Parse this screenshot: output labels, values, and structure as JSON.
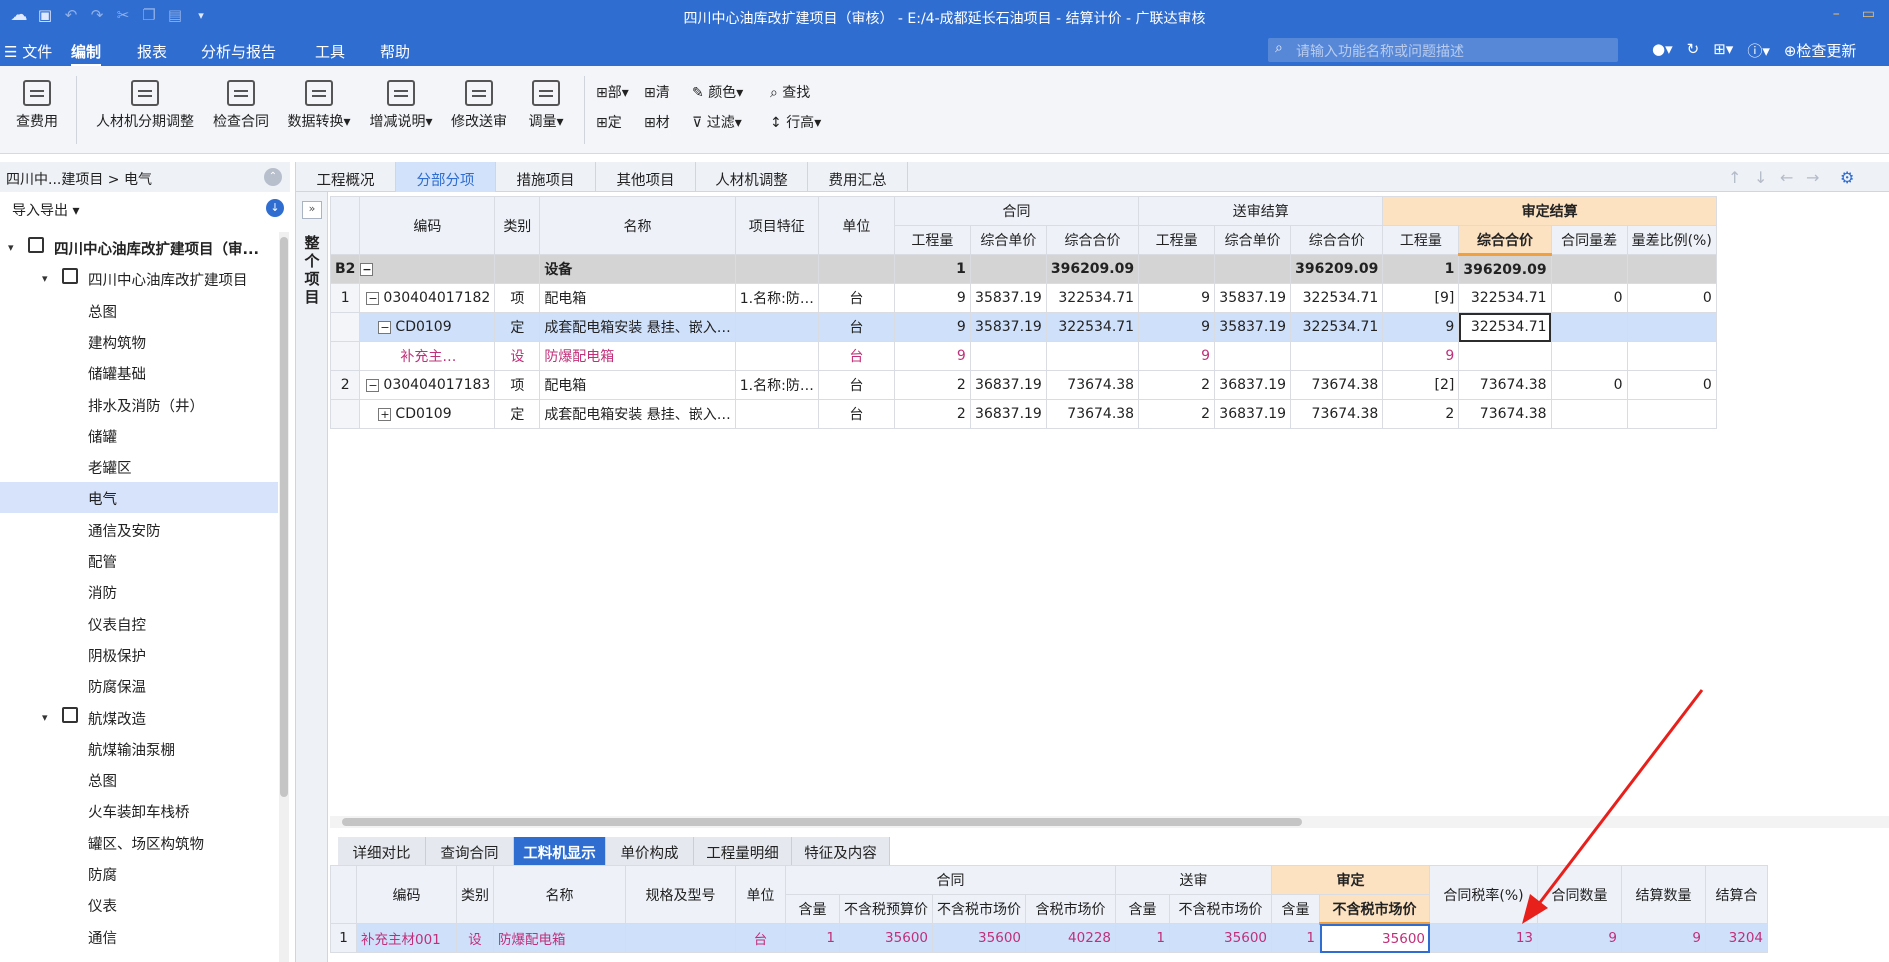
{
  "titlebar": {
    "title": "四川中心油库改扩建项目（审核） - E:/4-成都延长石油项目 - 结算计价 - 广联达审核"
  },
  "menubar": {
    "items": [
      "文件",
      "编制",
      "报表",
      "分析与报告",
      "工具",
      "帮助"
    ],
    "active": "编制",
    "search_placeholder": "请输入功能名称或问题描述",
    "check_update": "检查更新"
  },
  "ribbon": {
    "buttons": [
      "查费用",
      "人材机分期调整",
      "检查合同",
      "数据转换",
      "增减说明",
      "修改送审",
      "调量"
    ],
    "small": [
      "部",
      "清",
      "定",
      "材",
      "颜色",
      "过滤",
      "查找",
      "行高"
    ]
  },
  "leftpanel": {
    "breadcrumb": "四川中...建项目 > 电气",
    "io": "导入导出",
    "tree": [
      {
        "label": "四川中心油库改扩建项目（审...",
        "level": 0,
        "bold": true
      },
      {
        "label": "四川中心油库改扩建项目",
        "level": 1
      },
      {
        "label": "总图",
        "level": 2
      },
      {
        "label": "建构筑物",
        "level": 2
      },
      {
        "label": "储罐基础",
        "level": 2
      },
      {
        "label": "排水及消防（井）",
        "level": 2
      },
      {
        "label": "储罐",
        "level": 2
      },
      {
        "label": "老罐区",
        "level": 2
      },
      {
        "label": "电气",
        "level": 2,
        "selected": true
      },
      {
        "label": "通信及安防",
        "level": 2
      },
      {
        "label": "配管",
        "level": 2
      },
      {
        "label": "消防",
        "level": 2
      },
      {
        "label": "仪表自控",
        "level": 2
      },
      {
        "label": "阴极保护",
        "level": 2
      },
      {
        "label": "防腐保温",
        "level": 2
      },
      {
        "label": "航煤改造",
        "level": 1
      },
      {
        "label": "航煤输油泵棚",
        "level": 2
      },
      {
        "label": "总图",
        "level": 2
      },
      {
        "label": "火车装卸车栈桥",
        "level": 2
      },
      {
        "label": "罐区、场区构筑物",
        "level": 2
      },
      {
        "label": "防腐",
        "level": 2
      },
      {
        "label": "仪表",
        "level": 2
      },
      {
        "label": "通信",
        "level": 2
      }
    ]
  },
  "main": {
    "tabs": [
      "工程概况",
      "分部分项",
      "措施项目",
      "其他项目",
      "人材机调整",
      "费用汇总"
    ],
    "active_tab": "分部分项",
    "side_label": "整个项目",
    "grid": {
      "group_headers": {
        "contract": "合同",
        "submit": "送审结算",
        "approved": "审定结算"
      },
      "headers": {
        "code": "编码",
        "type": "类别",
        "name": "名称",
        "feature": "项目特征",
        "unit": "单位",
        "qty": "工程量",
        "unit_price": "综合单价",
        "total": "综合合价",
        "diff": "合同量差",
        "ratio": "量差比例(%)"
      },
      "rows": [
        {
          "no": "B2",
          "code": "",
          "type": "",
          "name": "设备",
          "feature": "",
          "unit": "",
          "c_qty": "1",
          "c_up": "",
          "c_tot": "396209.09",
          "s_qty": "",
          "s_up": "",
          "s_tot": "396209.09",
          "a_qty": "1",
          "a_tot": "396209.09",
          "diff": "",
          "ratio": ""
        },
        {
          "no": "1",
          "code": "030404017182",
          "type": "项",
          "name": "配电箱",
          "feature": "1.名称:防…",
          "unit": "台",
          "c_qty": "9",
          "c_up": "35837.19",
          "c_tot": "322534.71",
          "s_qty": "9",
          "s_up": "35837.19",
          "s_tot": "322534.71",
          "a_qty": "[9]",
          "a_tot": "322534.71",
          "diff": "0",
          "ratio": "0"
        },
        {
          "no": "",
          "code": "CD0109",
          "type": "定",
          "name": "成套配电箱安装 悬挂、嵌入…",
          "feature": "",
          "unit": "台",
          "c_qty": "9",
          "c_up": "35837.19",
          "c_tot": "322534.71",
          "s_qty": "9",
          "s_up": "35837.19",
          "s_tot": "322534.71",
          "a_qty": "9",
          "a_tot": "322534.71",
          "diff": "",
          "ratio": ""
        },
        {
          "no": "",
          "code": "补充主…",
          "type": "设",
          "name": "防爆配电箱",
          "feature": "",
          "unit": "台",
          "c_qty": "9",
          "c_up": "",
          "c_tot": "",
          "s_qty": "9",
          "s_up": "",
          "s_tot": "",
          "a_qty": "9",
          "a_tot": "",
          "diff": "",
          "ratio": ""
        },
        {
          "no": "2",
          "code": "030404017183",
          "type": "项",
          "name": "配电箱",
          "feature": "1.名称:防…",
          "unit": "台",
          "c_qty": "2",
          "c_up": "36837.19",
          "c_tot": "73674.38",
          "s_qty": "2",
          "s_up": "36837.19",
          "s_tot": "73674.38",
          "a_qty": "[2]",
          "a_tot": "73674.38",
          "diff": "0",
          "ratio": "0"
        },
        {
          "no": "",
          "code": "CD0109",
          "type": "定",
          "name": "成套配电箱安装 悬挂、嵌入…",
          "feature": "",
          "unit": "台",
          "c_qty": "2",
          "c_up": "36837.19",
          "c_tot": "73674.38",
          "s_qty": "2",
          "s_up": "36837.19",
          "s_tot": "73674.38",
          "a_qty": "2",
          "a_tot": "73674.38",
          "diff": "",
          "ratio": ""
        }
      ]
    },
    "bottom": {
      "tabs": [
        "详细对比",
        "查询合同",
        "工料机显示",
        "单价构成",
        "工程量明细",
        "特征及内容"
      ],
      "active_tab": "工料机显示",
      "group_headers": {
        "contract": "合同",
        "submit": "送审",
        "approved": "审定"
      },
      "headers": {
        "code": "编码",
        "type": "类别",
        "name": "名称",
        "spec": "规格及型号",
        "unit": "单位",
        "content": "含量",
        "ex_budget": "不含税预算价",
        "ex_market": "不含税市场价",
        "in_market": "含税市场价",
        "tax": "合同税率(%)",
        "c_count": "合同数量",
        "s_count": "结算数量",
        "s_total": "结算合"
      },
      "row": {
        "no": "1",
        "code": "补充主材001",
        "type": "设",
        "name": "防爆配电箱",
        "spec": "",
        "unit": "台",
        "c_content": "1",
        "c_ex_budget": "35600",
        "c_ex_market": "35600",
        "c_in_market": "40228",
        "s_content": "1",
        "s_ex_market": "35600",
        "a_content": "1",
        "a_ex_market": "35600",
        "tax": "13",
        "c_count": "9",
        "s_count": "9",
        "s_total": "3204"
      }
    }
  }
}
